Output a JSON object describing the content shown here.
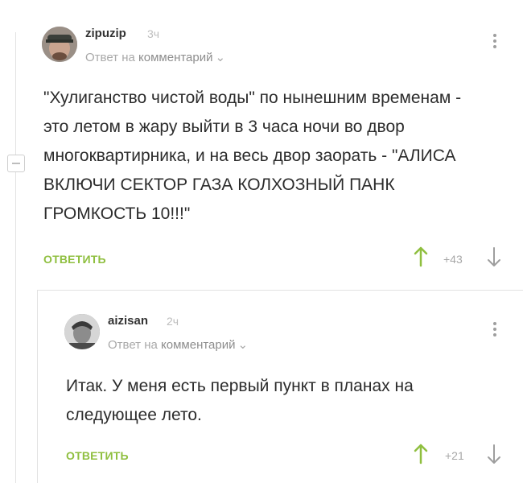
{
  "comments": [
    {
      "username": "zipuzip",
      "time": "3ч",
      "reply_to_prefix": "Ответ на",
      "reply_to_target": "комментарий",
      "reply_to_chevron": "⌄",
      "body": "\"Хулиганство чистой воды\" по нынешним временам - это летом в жару выйти в 3 часа ночи во двор многоквартирника, и на весь двор заорать - \"АЛИСА ВКЛЮЧИ СЕКТОР ГАЗА КОЛХОЗНЫЙ ПАНК ГРОМКОСТЬ 10!!!\"",
      "reply_label": "ОТВЕТИТЬ",
      "rating": "+43"
    },
    {
      "username": "aizisan",
      "time": "2ч",
      "reply_to_prefix": "Ответ на",
      "reply_to_target": "комментарий",
      "reply_to_chevron": "⌄",
      "body": "Итак. У меня есть первый пункт в планах на следующее лето.",
      "reply_label": "ОТВЕТИТЬ",
      "rating": "+21"
    }
  ],
  "colors": {
    "accent_green": "#8fbf3f",
    "arrow_down": "#9e9e9e",
    "muted": "#a9a9a9"
  }
}
